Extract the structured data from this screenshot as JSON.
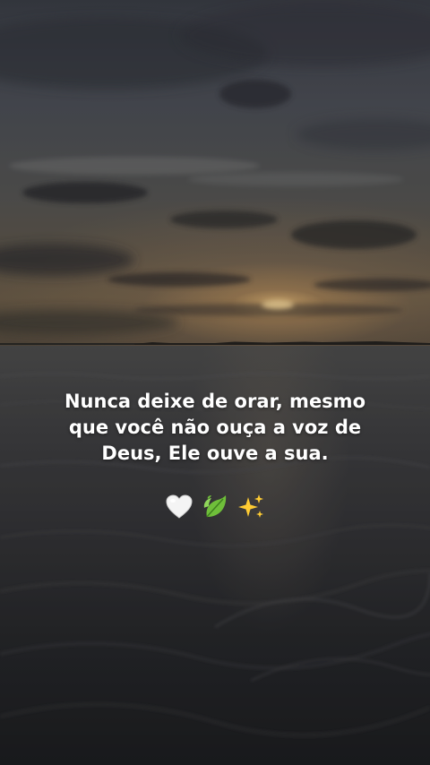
{
  "caption": {
    "lines": [
      "Nunca deixe de orar, mesmo",
      "que você não ouça a voz de",
      "Deus, Ele ouve a sua."
    ]
  },
  "emojis": [
    {
      "icon": "white-heart-icon",
      "char": "🤍"
    },
    {
      "icon": "leaf-icon",
      "char": "🍃"
    },
    {
      "icon": "sparkles-icon",
      "char": "✨"
    }
  ],
  "colors": {
    "text": "#ffffff",
    "sun": "#ecbe78",
    "sea": "#2a2b2e"
  }
}
